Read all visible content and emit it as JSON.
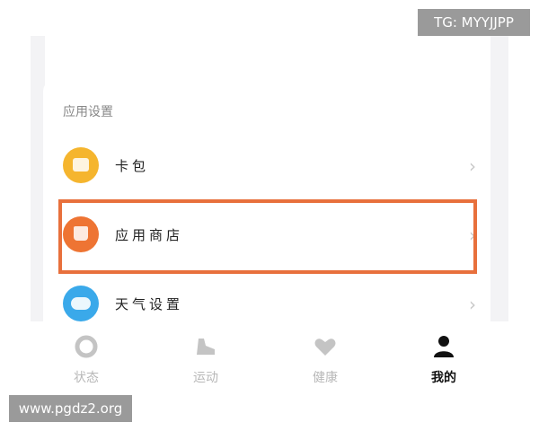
{
  "settings_section": {
    "title": "应用设置",
    "items": [
      {
        "label": "卡包",
        "icon": "wallet-icon",
        "color": "#f5b52e"
      },
      {
        "label": "应用商店",
        "icon": "store-bag-icon",
        "color": "#ee7433"
      },
      {
        "label": "天气设置",
        "icon": "weather-cloud-icon",
        "color": "#3aa9ea"
      }
    ],
    "chevron": "›"
  },
  "highlight_color": "#e8703c",
  "tabbar": {
    "tabs": [
      {
        "label": "状态",
        "icon": "status-ring-icon",
        "active": false
      },
      {
        "label": "运动",
        "icon": "shoe-icon",
        "active": false
      },
      {
        "label": "健康",
        "icon": "heart-icon",
        "active": false
      },
      {
        "label": "我的",
        "icon": "person-icon",
        "active": true
      }
    ]
  },
  "watermarks": {
    "top_right": "TG: MYYJJPP",
    "bottom_left": "www.pgdz2.org"
  }
}
